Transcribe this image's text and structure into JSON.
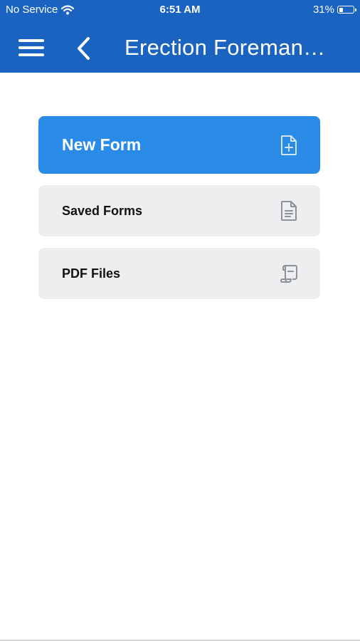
{
  "status_bar": {
    "carrier": "No Service",
    "time": "6:51 AM",
    "battery_percent_text": "31%",
    "battery_level": 0.31
  },
  "nav": {
    "title": "Erection Foreman…",
    "menu_icon": "hamburger-menu-icon",
    "back_icon": "chevron-left-icon"
  },
  "menu": {
    "items": [
      {
        "label": "New Form",
        "icon": "file-plus-icon"
      },
      {
        "label": "Saved Forms",
        "icon": "file-text-icon"
      },
      {
        "label": "PDF Files",
        "icon": "scroll-document-icon"
      }
    ]
  },
  "colors": {
    "header": "#1b63c1",
    "primary_button": "#2a8be6",
    "secondary_button": "#eceef0",
    "icon_muted": "#8e9296"
  }
}
